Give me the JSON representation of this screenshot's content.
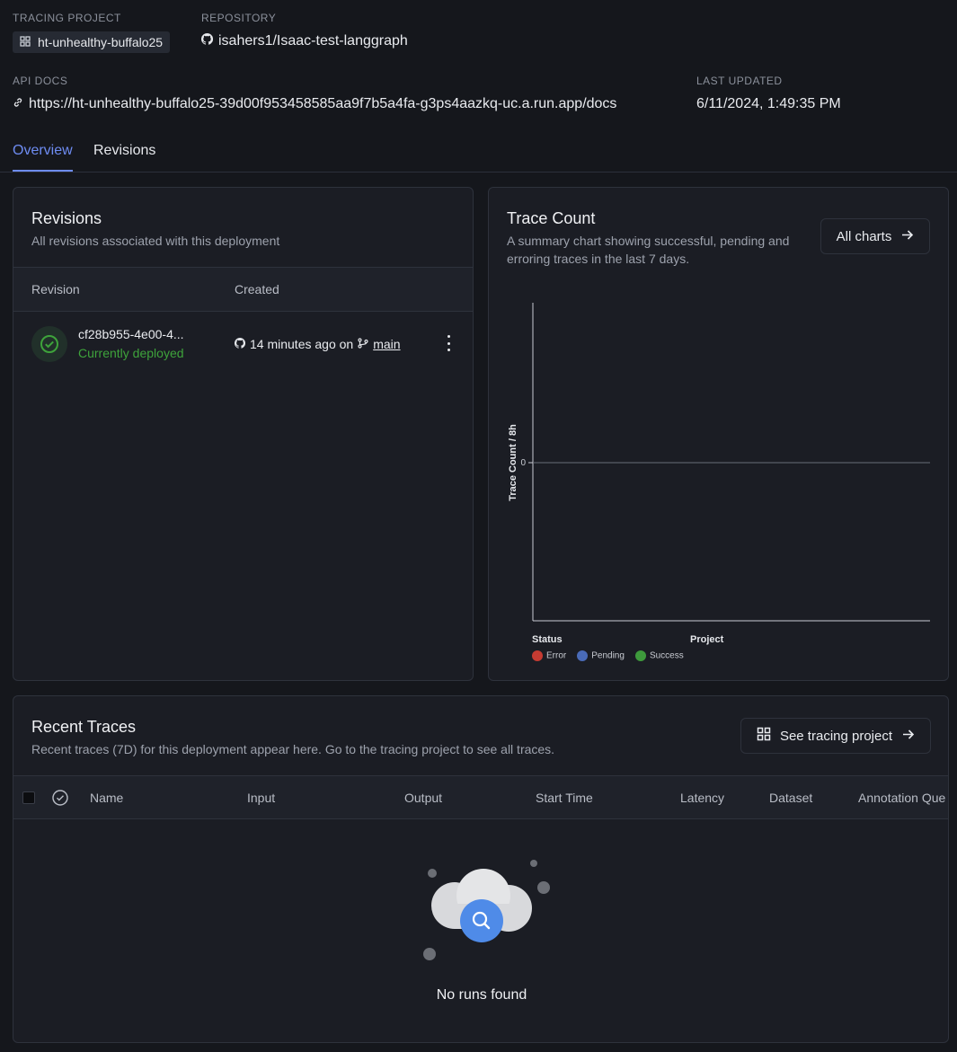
{
  "header": {
    "tracing_project_label": "TRACING PROJECT",
    "tracing_project": "ht-unhealthy-buffalo25",
    "repository_label": "REPOSITORY",
    "repository": "isahers1/Isaac-test-langgraph",
    "api_docs_label": "API DOCS",
    "api_docs_url": "https://ht-unhealthy-buffalo25-39d00f953458585aa9f7b5a4fa-g3ps4aazkq-uc.a.run.app/docs",
    "last_updated_label": "LAST UPDATED",
    "last_updated": "6/11/2024, 1:49:35 PM"
  },
  "tabs": [
    {
      "label": "Overview",
      "active": true
    },
    {
      "label": "Revisions",
      "active": false
    }
  ],
  "revisions_card": {
    "title": "Revisions",
    "subtitle": "All revisions associated with this deployment",
    "columns": [
      "Revision",
      "Created"
    ],
    "rows": [
      {
        "revision": "cf28b955-4e00-4...",
        "status": "Currently deployed",
        "created_text": "14 minutes ago on",
        "branch": "main",
        "status_icon": "check-circle-icon"
      }
    ]
  },
  "trace_count_card": {
    "title": "Trace Count",
    "subtitle": "A summary chart showing successful, pending and erroring traces in the last 7 days.",
    "all_charts_label": "All charts",
    "legend_status_title": "Status",
    "legend_project_title": "Project",
    "legend": [
      {
        "name": "Error",
        "color": "#c53b32"
      },
      {
        "name": "Pending",
        "color": "#4a6bb8"
      },
      {
        "name": "Success",
        "color": "#3e9a3c"
      }
    ]
  },
  "chart_data": {
    "type": "bar",
    "ylabel": "Trace Count / 8h",
    "xlabel": "",
    "yticks": [
      "0"
    ],
    "series": [
      {
        "name": "Error",
        "values": []
      },
      {
        "name": "Pending",
        "values": []
      },
      {
        "name": "Success",
        "values": []
      }
    ]
  },
  "recent_traces": {
    "title": "Recent Traces",
    "subtitle": "Recent traces (7D) for this deployment appear here. Go to the tracing project to see all traces.",
    "see_project_label": "See tracing project",
    "columns": [
      "Name",
      "Input",
      "Output",
      "Start Time",
      "Latency",
      "Dataset",
      "Annotation Que"
    ],
    "empty_text": "No runs found"
  },
  "colors": {
    "accent": "#6e8cf2",
    "success": "#3ea33b",
    "background": "#15171c",
    "card": "#1b1d24"
  }
}
